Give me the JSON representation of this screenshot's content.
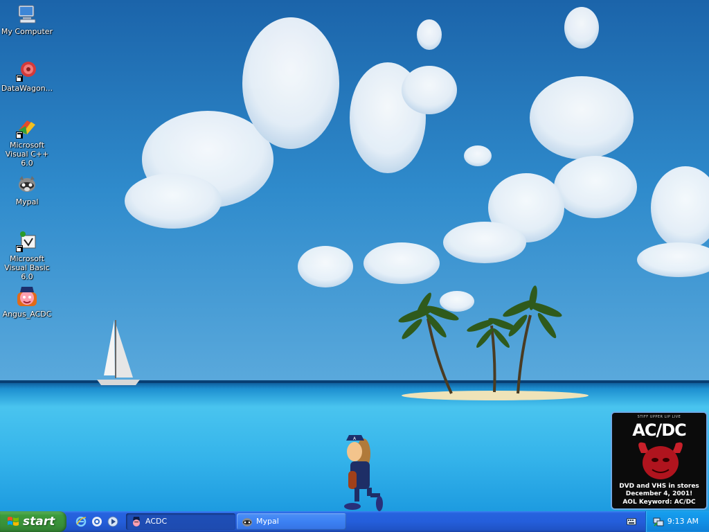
{
  "desktop": {
    "icons": [
      {
        "label": "My Computer",
        "icon": "my-computer-icon"
      },
      {
        "label": "DataWagon...",
        "icon": "datawagon-icon"
      },
      {
        "label": "Microsoft Visual C++ 6.0",
        "icon": "visual-cpp-icon"
      },
      {
        "label": "Mypal",
        "icon": "mypal-icon"
      },
      {
        "label": "Microsoft Visual Basic 6.0",
        "icon": "visual-basic-icon"
      },
      {
        "label": "Angus_ACDC",
        "icon": "angus-acdc-icon"
      }
    ]
  },
  "ad": {
    "tagline": "STIFF UPPER LIP LIVE",
    "band": "AC/DC",
    "line1a": "DVD and VHS in stores",
    "line1b": "December 4, 2001!",
    "line2": "AOL Keyword: AC/DC"
  },
  "taskbar": {
    "start_label": "start",
    "quick_launch": [
      "ie-icon",
      "outlook-express-icon",
      "media-player-icon"
    ],
    "tasks": [
      {
        "label": "ACDC",
        "state": "active"
      },
      {
        "label": "Mypal",
        "state": "normal"
      }
    ],
    "clock": "9:13 AM"
  },
  "colors": {
    "taskbar_blue": "#245edb",
    "start_green": "#3c9b3c",
    "tray_blue": "#1290e6"
  }
}
